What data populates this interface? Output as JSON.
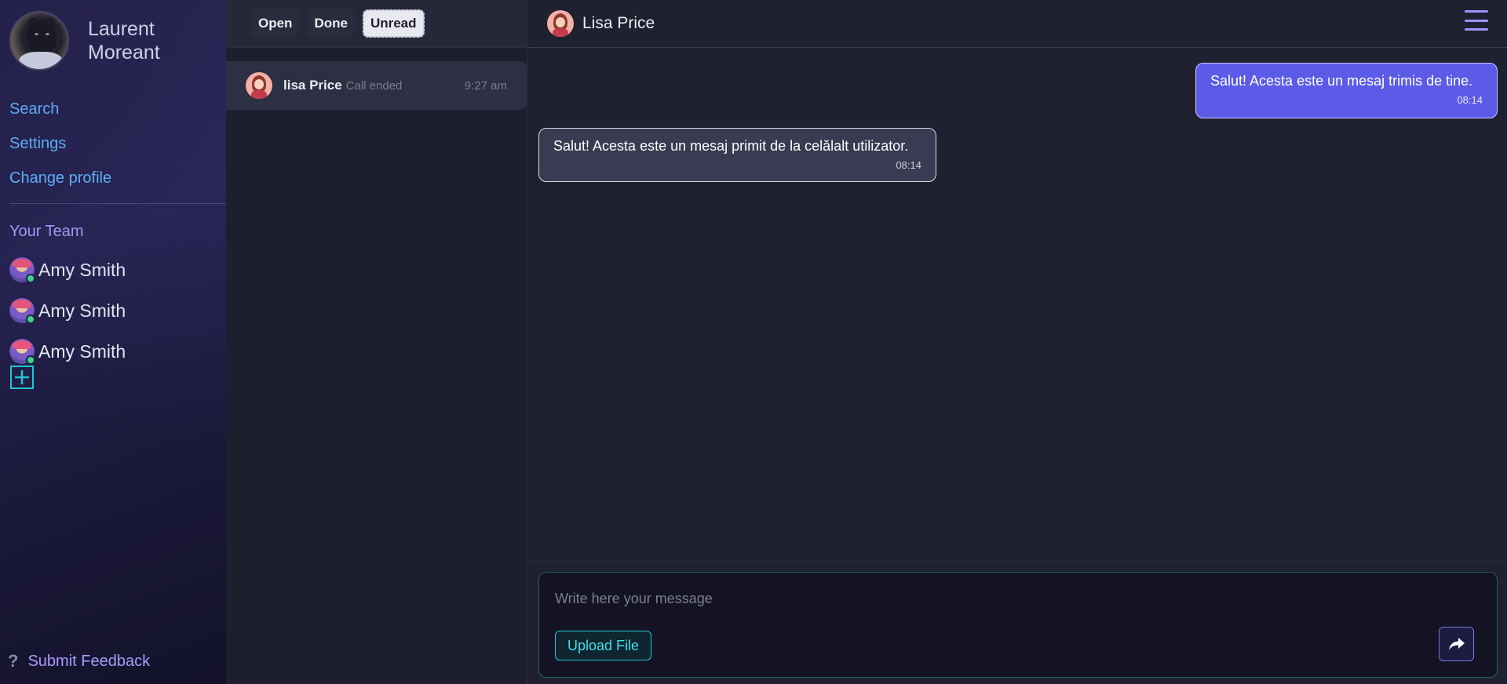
{
  "sidebar": {
    "profile_name": "Laurent Moreant",
    "nav": {
      "search": "Search",
      "settings": "Settings",
      "change_profile": "Change profile"
    },
    "team_title": "Your Team",
    "team": [
      {
        "name": "Amy Smith",
        "status": "online"
      },
      {
        "name": "Amy Smith",
        "status": "online"
      },
      {
        "name": "Amy Smith",
        "status": "online"
      }
    ],
    "add_icon": "plus-square-icon",
    "feedback_label": "Submit Feedback",
    "feedback_icon": "question-icon"
  },
  "filters": {
    "open": "Open",
    "done": "Done",
    "unread": "Unread",
    "active": "Unread"
  },
  "conversations": [
    {
      "name": "lisa Price",
      "status": "Call ended",
      "time": "9:27 am"
    }
  ],
  "chat": {
    "title": "Lisa Price",
    "menu_icon": "hamburger-menu-icon",
    "messages": [
      {
        "direction": "sent",
        "text": "Salut! Acesta este un mesaj trimis de tine.",
        "time": "08:14"
      },
      {
        "direction": "received",
        "text": "Salut! Acesta este un mesaj primit de la celălalt utilizator.",
        "time": "08:14"
      }
    ],
    "composer": {
      "placeholder": "Write here your message",
      "value": "",
      "upload_label": "Upload File",
      "send_icon": "share-arrow-icon"
    }
  },
  "colors": {
    "accent": "#5b5be8",
    "link": "#5cb8ff",
    "team_title": "#a99cff",
    "cyan": "#20c8d6",
    "online": "#3dd68c"
  }
}
